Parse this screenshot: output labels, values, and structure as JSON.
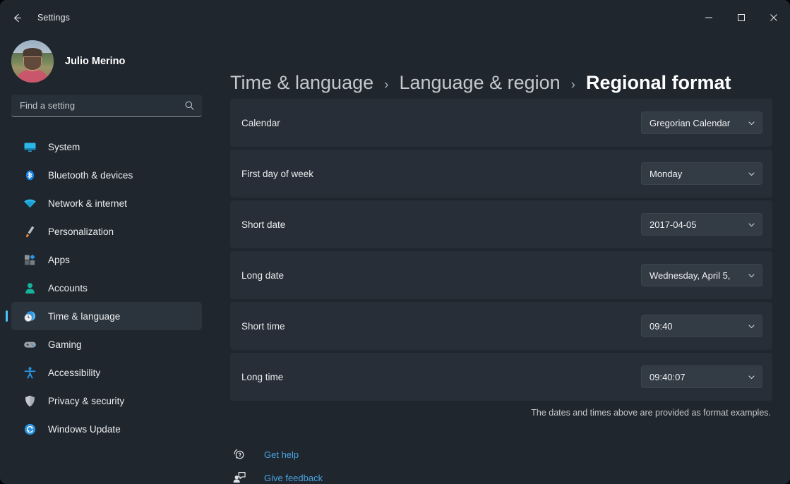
{
  "window": {
    "title": "Settings",
    "back_icon": "back-arrow-icon",
    "controls": [
      {
        "name": "minimize-button",
        "label": "Minimize"
      },
      {
        "name": "maximize-button",
        "label": "Maximize"
      },
      {
        "name": "close-button",
        "label": "Close"
      }
    ]
  },
  "colors": {
    "window_bg": "#1f262e",
    "card_bg": "#272e37",
    "dropdown_bg": "#333b45",
    "accent": "#4cc2ff",
    "link": "#4aa3e0",
    "selected_nav_bg": "#2b333c",
    "text_primary": "#ffffff",
    "text_secondary": "#c3c8cc"
  },
  "sidebar": {
    "profile": {
      "name": "Julio Merino",
      "avatar_icon": "user-avatar-photo"
    },
    "search": {
      "value": "",
      "placeholder": "Find a setting",
      "icon": "search-icon"
    },
    "items": [
      {
        "label": "System",
        "icon": "monitor-icon",
        "selected": false
      },
      {
        "label": "Bluetooth & devices",
        "icon": "bluetooth-icon",
        "selected": false
      },
      {
        "label": "Network & internet",
        "icon": "wifi-icon",
        "selected": false
      },
      {
        "label": "Personalization",
        "icon": "paintbrush-icon",
        "selected": false
      },
      {
        "label": "Apps",
        "icon": "apps-grid-icon",
        "selected": false
      },
      {
        "label": "Accounts",
        "icon": "person-icon",
        "selected": false
      },
      {
        "label": "Time & language",
        "icon": "clock-globe-icon",
        "selected": true
      },
      {
        "label": "Gaming",
        "icon": "gamepad-icon",
        "selected": false
      },
      {
        "label": "Accessibility",
        "icon": "accessibility-person-icon",
        "selected": false
      },
      {
        "label": "Privacy & security",
        "icon": "shield-icon",
        "selected": false
      },
      {
        "label": "Windows Update",
        "icon": "update-refresh-icon",
        "selected": false
      }
    ]
  },
  "main": {
    "breadcrumb": [
      {
        "label": "Time & language",
        "current": false
      },
      {
        "label": "Language & region",
        "current": false
      },
      {
        "label": "Regional format",
        "current": true
      }
    ],
    "breadcrumb_separator": "›",
    "settings": [
      {
        "label": "Calendar",
        "value": "Gregorian Calendar",
        "name": "calendar"
      },
      {
        "label": "First day of week",
        "value": "Monday",
        "name": "first-day-of-week"
      },
      {
        "label": "Short date",
        "value": "2017-04-05",
        "name": "short-date"
      },
      {
        "label": "Long date",
        "value": "Wednesday, April 5,",
        "name": "long-date"
      },
      {
        "label": "Short time",
        "value": "09:40",
        "name": "short-time"
      },
      {
        "label": "Long time",
        "value": "09:40:07",
        "name": "long-time"
      }
    ],
    "note": "The dates and times above are provided as format examples.",
    "links": [
      {
        "label": "Get help",
        "icon": "help-bubble-icon",
        "name": "get-help"
      },
      {
        "label": "Give feedback",
        "icon": "feedback-person-icon",
        "name": "give-feedback"
      }
    ]
  }
}
